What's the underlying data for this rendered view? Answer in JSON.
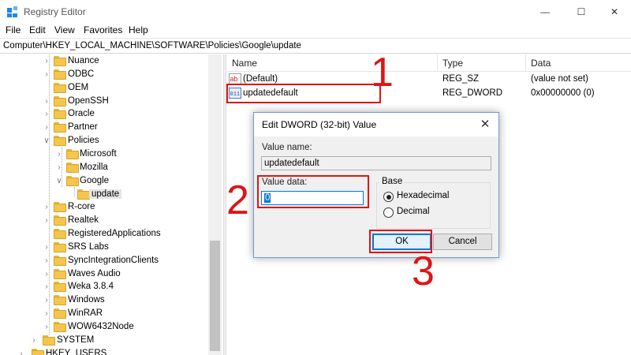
{
  "window": {
    "title": "Registry Editor",
    "minimize_glyph": "—",
    "maximize_glyph": "☐",
    "close_glyph": "✕"
  },
  "menu": [
    "File",
    "Edit",
    "View",
    "Favorites",
    "Help"
  ],
  "address": "Computer\\HKEY_LOCAL_MACHINE\\SOFTWARE\\Policies\\Google\\update",
  "tree": {
    "items": [
      {
        "label": "Nuance",
        "level": 1,
        "expander": ">"
      },
      {
        "label": "ODBC",
        "level": 1,
        "expander": ">"
      },
      {
        "label": "OEM",
        "level": 1,
        "expander": ""
      },
      {
        "label": "OpenSSH",
        "level": 1,
        "expander": ">"
      },
      {
        "label": "Oracle",
        "level": 1,
        "expander": ">"
      },
      {
        "label": "Partner",
        "level": 1,
        "expander": ">"
      },
      {
        "label": "Policies",
        "level": 1,
        "expander": "v"
      },
      {
        "label": "Microsoft",
        "level": 2,
        "expander": ">"
      },
      {
        "label": "Mozilla",
        "level": 2,
        "expander": ">"
      },
      {
        "label": "Google",
        "level": 2,
        "expander": "v"
      },
      {
        "label": "update",
        "level": 3,
        "expander": "",
        "selected": true
      },
      {
        "label": "R-core",
        "level": 1,
        "expander": ">"
      },
      {
        "label": "Realtek",
        "level": 1,
        "expander": ">"
      },
      {
        "label": "RegisteredApplications",
        "level": 1,
        "expander": ""
      },
      {
        "label": "SRS Labs",
        "level": 1,
        "expander": ">"
      },
      {
        "label": "SyncIntegrationClients",
        "level": 1,
        "expander": ">"
      },
      {
        "label": "Waves Audio",
        "level": 1,
        "expander": ">"
      },
      {
        "label": "Weka 3.8.4",
        "level": 1,
        "expander": ">"
      },
      {
        "label": "Windows",
        "level": 1,
        "expander": ">"
      },
      {
        "label": "WinRAR",
        "level": 1,
        "expander": ">"
      },
      {
        "label": "WOW6432Node",
        "level": 1,
        "expander": ">"
      },
      {
        "label": "SYSTEM",
        "level": 0,
        "expander": ">"
      },
      {
        "label": "HKEY_USERS",
        "level": -1,
        "expander": ">"
      }
    ]
  },
  "list": {
    "columns": [
      "Name",
      "Type",
      "Data"
    ],
    "rows": [
      {
        "name": "(Default)",
        "type": "REG_SZ",
        "data": "(value not set)",
        "icon": "string-value-icon",
        "icon_text": "ab"
      },
      {
        "name": "updatedefault",
        "type": "REG_DWORD",
        "data": "0x00000000 (0)",
        "icon": "binary-value-icon",
        "icon_text": "011"
      }
    ]
  },
  "dialog": {
    "title": "Edit DWORD (32-bit) Value",
    "close_glyph": "✕",
    "value_name_label": "Value name:",
    "value_name": "updatedefault",
    "value_data_label": "Value data:",
    "value_data": "0",
    "base_label": "Base",
    "base_options": [
      {
        "label": "Hexadecimal",
        "selected": true
      },
      {
        "label": "Decimal",
        "selected": false
      }
    ],
    "ok_label": "OK",
    "cancel_label": "Cancel"
  },
  "annotations": {
    "step1": "1",
    "step2": "2",
    "step3": "3",
    "color": "#e01414"
  }
}
